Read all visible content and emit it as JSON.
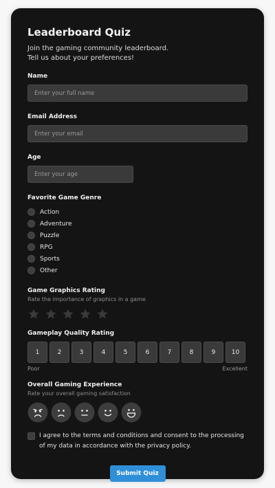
{
  "form": {
    "title": "Leaderboard Quiz",
    "subtitle_line1": "Join the gaming community leaderboard.",
    "subtitle_line2": "Tell us about your preferences!",
    "name": {
      "label": "Name",
      "placeholder": "Enter your full name"
    },
    "email": {
      "label": "Email Address",
      "placeholder": "Enter your email"
    },
    "age": {
      "label": "Age",
      "placeholder": "Enter your age"
    },
    "genre": {
      "label": "Favorite Game Genre",
      "options": [
        "Action",
        "Adventure",
        "Puzzle",
        "RPG",
        "Sports",
        "Other"
      ]
    },
    "graphics": {
      "label": "Game Graphics Rating",
      "hint": "Rate the importance of graphics in a game",
      "max_stars": 5,
      "value": 0
    },
    "gameplay": {
      "label": "Gameplay Quality Rating",
      "scale": [
        "1",
        "2",
        "3",
        "4",
        "5",
        "6",
        "7",
        "8",
        "9",
        "10"
      ],
      "low_label": "Poor",
      "high_label": "Excellent"
    },
    "experience": {
      "label": "Overall Gaming Experience",
      "hint": "Rate your overall gaming satisfaction",
      "faces": [
        "angry-face-icon",
        "sad-face-icon",
        "neutral-face-icon",
        "happy-face-icon",
        "very-happy-face-icon"
      ]
    },
    "consent": {
      "text": "I agree to the terms and conditions and consent to the processing of my data in accordance with the privacy policy."
    },
    "submit_label": "Submit Quiz"
  },
  "colors": {
    "card_bg": "#141414",
    "input_bg": "#3a3a3a",
    "accent": "#2f8fd8",
    "star": "#3a3a3a"
  }
}
